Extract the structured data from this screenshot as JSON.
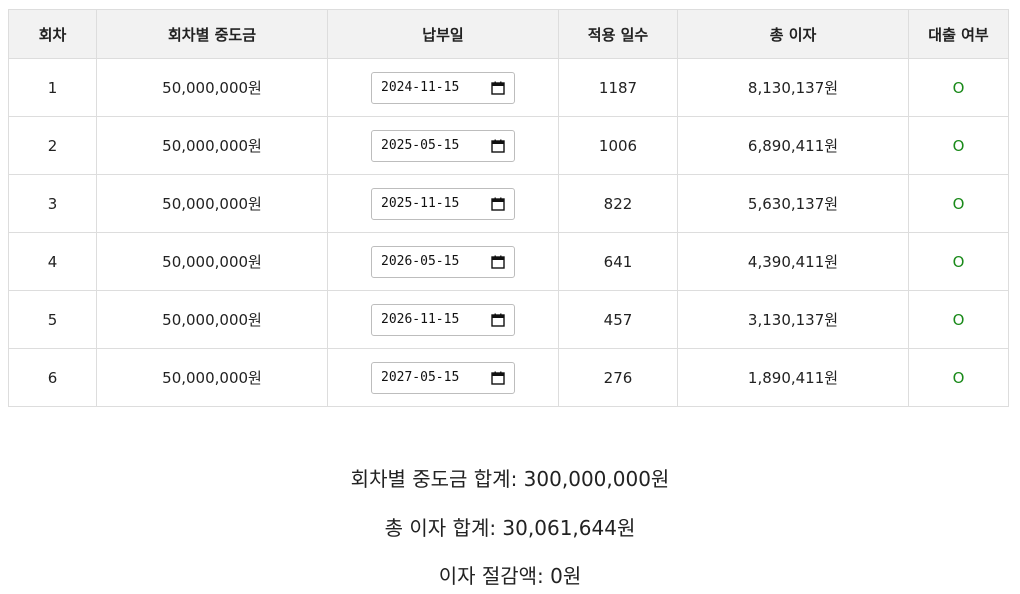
{
  "table": {
    "headers": [
      "회차",
      "회차별 중도금",
      "납부일",
      "적용 일수",
      "총 이자",
      "대출 여부"
    ],
    "rows": [
      {
        "round": "1",
        "amount": "50,000,000원",
        "date": "2024-11-15",
        "days": "1187",
        "interest": "8,130,137원",
        "loan": "O"
      },
      {
        "round": "2",
        "amount": "50,000,000원",
        "date": "2025-05-15",
        "days": "1006",
        "interest": "6,890,411원",
        "loan": "O"
      },
      {
        "round": "3",
        "amount": "50,000,000원",
        "date": "2025-11-15",
        "days": "822",
        "interest": "5,630,137원",
        "loan": "O"
      },
      {
        "round": "4",
        "amount": "50,000,000원",
        "date": "2026-05-15",
        "days": "641",
        "interest": "4,390,411원",
        "loan": "O"
      },
      {
        "round": "5",
        "amount": "50,000,000원",
        "date": "2026-11-15",
        "days": "457",
        "interest": "3,130,137원",
        "loan": "O"
      },
      {
        "round": "6",
        "amount": "50,000,000원",
        "date": "2027-05-15",
        "days": "276",
        "interest": "1,890,411원",
        "loan": "O"
      }
    ]
  },
  "summary": {
    "total_amount": "회차별 중도금 합계: 300,000,000원",
    "total_interest": "총 이자 합계: 30,061,644원",
    "interest_saving": "이자 절감액: 0원"
  },
  "icons": {
    "date_picker": "calendar-icon"
  },
  "colors": {
    "loan_yes": "#1a8a1a",
    "header_bg": "#f2f2f2",
    "border": "#dddddd"
  }
}
